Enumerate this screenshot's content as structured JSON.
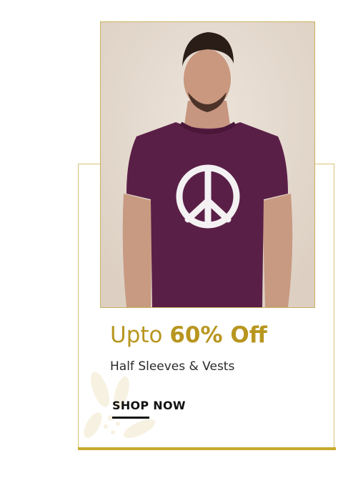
{
  "promo": {
    "image_alt": "Man wearing purple half sleeve t-shirt with white peace sign print",
    "headline_prefix": "Upto ",
    "headline_highlight": "60% Off",
    "subheadline": "Half Sleeves & Vests",
    "cta_label": "SHOP NOW"
  },
  "colors": {
    "accent_gold": "#b8961f",
    "border_gold": "#d9c27a",
    "tshirt_purple": "#5a1f47",
    "photo_background": "#e8ddd2"
  }
}
